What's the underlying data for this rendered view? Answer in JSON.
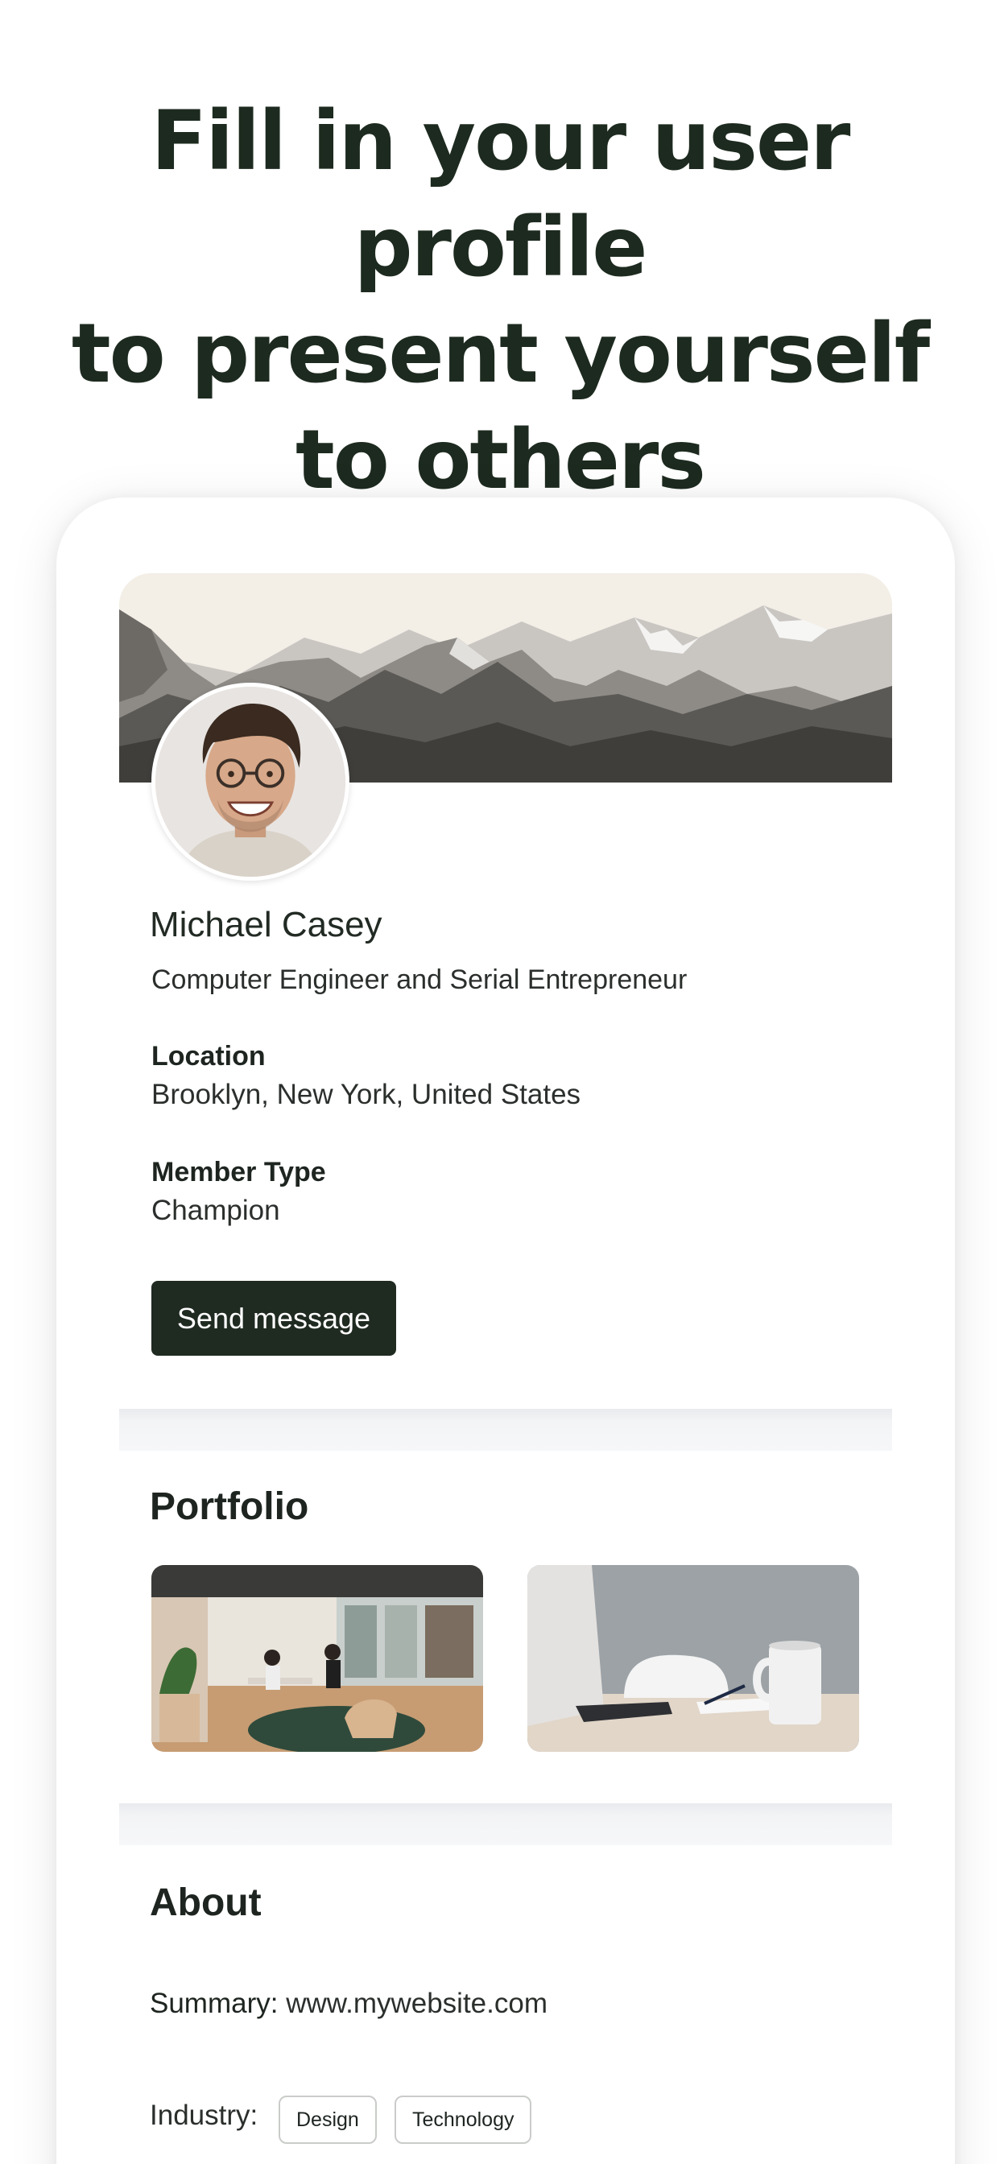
{
  "headline": {
    "line1": "Fill in your user profile",
    "line2": "to present yourself",
    "line3": "to others"
  },
  "profile": {
    "name": "Michael Casey",
    "title": "Computer Engineer and Serial Entrepreneur",
    "location_label": "Location",
    "location_value": "Brooklyn, New York, United States",
    "member_type_label": "Member Type",
    "member_type_value": "Champion",
    "send_message_label": "Send message"
  },
  "portfolio": {
    "title": "Portfolio",
    "images": [
      "office-lounge-photo",
      "desk-laptop-mug-photo"
    ]
  },
  "about": {
    "title": "About",
    "summary_label": "Summary:",
    "summary_value": "www.mywebsite.com",
    "industry_label": "Industry:",
    "industry_tags": [
      "Design",
      "Technology"
    ]
  },
  "colors": {
    "accent_dark": "#1f2a21",
    "text_primary": "#1e2520",
    "card_bg": "#ffffff"
  }
}
